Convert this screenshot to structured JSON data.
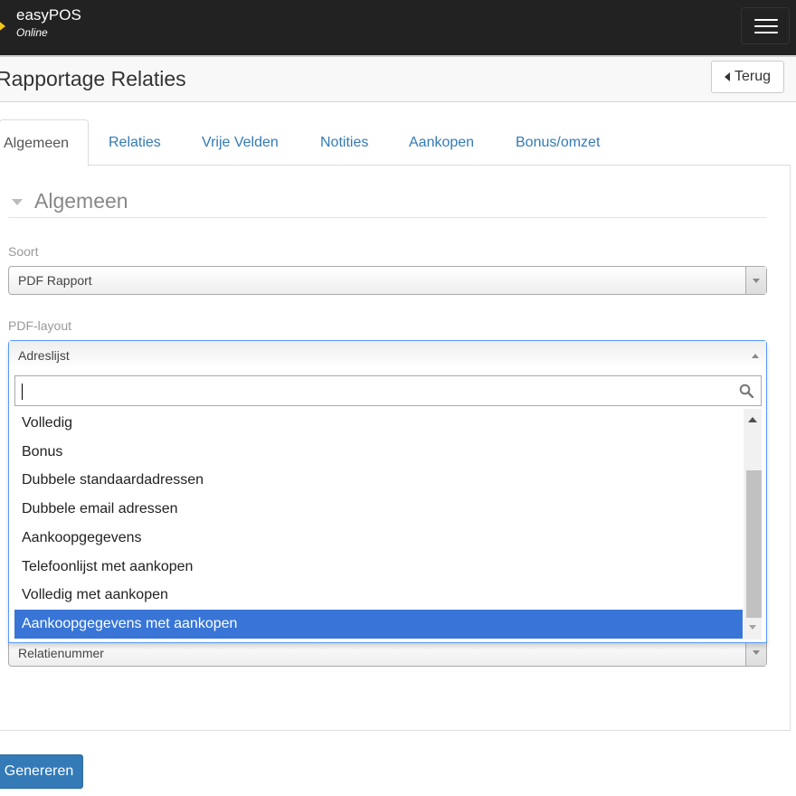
{
  "navbar": {
    "brand": "easyPOS",
    "brand_sub": "Online"
  },
  "header": {
    "title": "Rapportage Relaties",
    "back_label": "Terug"
  },
  "tabs": [
    {
      "label": "Algemeen",
      "active": true
    },
    {
      "label": "Relaties"
    },
    {
      "label": "Vrije Velden"
    },
    {
      "label": "Notities"
    },
    {
      "label": "Aankopen"
    },
    {
      "label": "Bonus/omzet"
    }
  ],
  "section": {
    "title": "Algemeen"
  },
  "fields": {
    "soort": {
      "label": "Soort",
      "value": "PDF Rapport"
    },
    "pdf_layout": {
      "label": "PDF-layout",
      "value": "Adreslijst",
      "search_value": "",
      "options": [
        "Volledig",
        "Bonus",
        "Dubbele standaardadressen",
        "Dubbele email adressen",
        "Aankoopgegevens",
        "Telefoonlijst met aankopen",
        "Volledig met aankopen",
        "Aankoopgegevens met aankopen"
      ],
      "highlighted": "Aankoopgegevens met aankopen"
    },
    "sortering": {
      "value": "Relatienummer"
    }
  },
  "actions": {
    "generate_label": "Genereren"
  },
  "colors": {
    "navbar": "#222222",
    "link": "#337ab7",
    "highlight": "#3875d7",
    "primary_button": "#337ab7"
  }
}
